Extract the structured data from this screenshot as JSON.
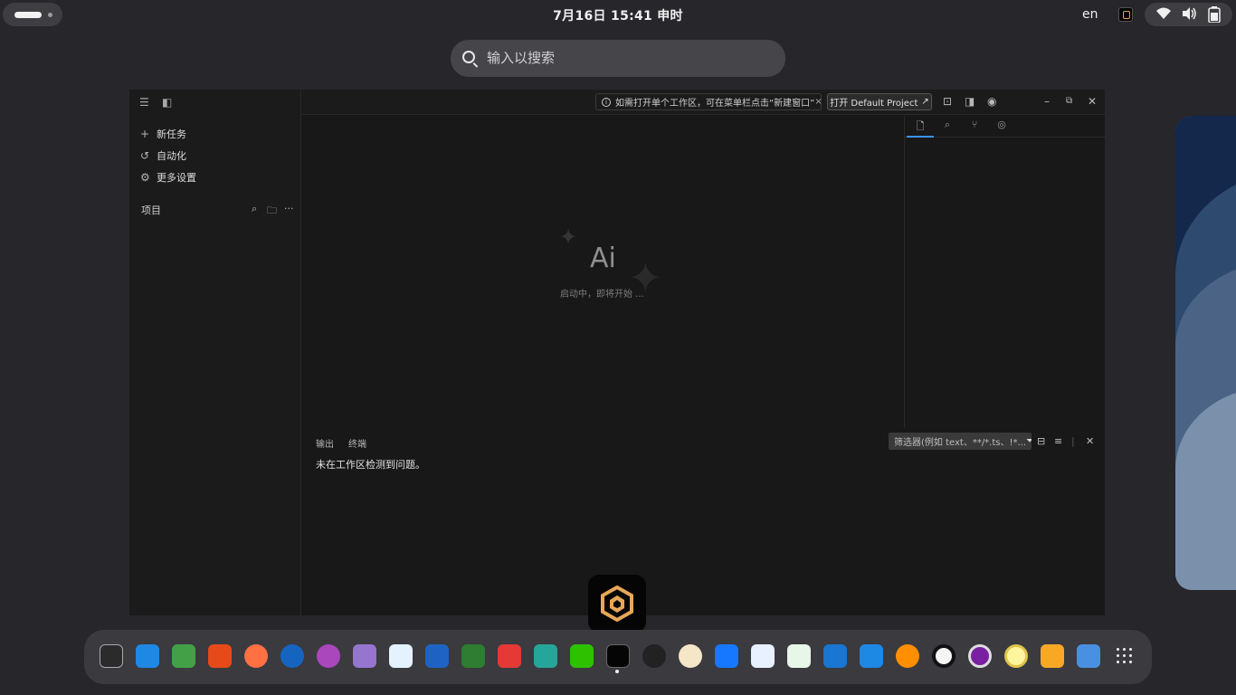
{
  "topbar": {
    "clock": "7月16日  15:41  申时",
    "input_language": "en",
    "wifi_icon": "wifi-icon",
    "volume_icon": "volume-icon",
    "battery_icon": "battery-icon"
  },
  "search": {
    "placeholder": "输入以搜索"
  },
  "app": {
    "sidebar": {
      "items": [
        {
          "icon": "plus-icon",
          "label": "新任务"
        },
        {
          "icon": "history-icon",
          "label": "自动化"
        },
        {
          "icon": "gear-icon",
          "label": "更多设置"
        }
      ],
      "projects_label": "项目"
    },
    "titlebar": {
      "notice": "如需打开单个工作区，可在菜单栏点击“新建窗口”",
      "open_project_label": "打开 Default Project"
    },
    "editor": {
      "ai_glyph": "Ai",
      "starting_text": "启动中，即将开始 ..."
    },
    "bottom_panel": {
      "tabs": [
        "输出",
        "终端"
      ],
      "filter_placeholder": "筛选器(例如 text、**/*.ts、!*...",
      "message": "未在工作区检测到问题。"
    }
  },
  "dock": {
    "items": [
      "terminal-icon",
      "writer-icon",
      "spreadsheet-icon",
      "presentation-icon",
      "firefox-icon",
      "thunderbird-icon",
      "cat-app-icon",
      "notes-icon",
      "store-icon",
      "word-icon",
      "excel-icon",
      "wps-icon",
      "layers-icon",
      "wechat-icon",
      "trae-icon",
      "qq-icon",
      "dict-icon",
      "feishu-icon",
      "baidu-netdisk-icon",
      "music-icon",
      "tiktok-icon",
      "todo-icon",
      "xmind-icon",
      "a-icon",
      "media-player-icon",
      "circle-app-icon",
      "radio-icon",
      "phone-icon",
      "app-grid-icon"
    ]
  }
}
